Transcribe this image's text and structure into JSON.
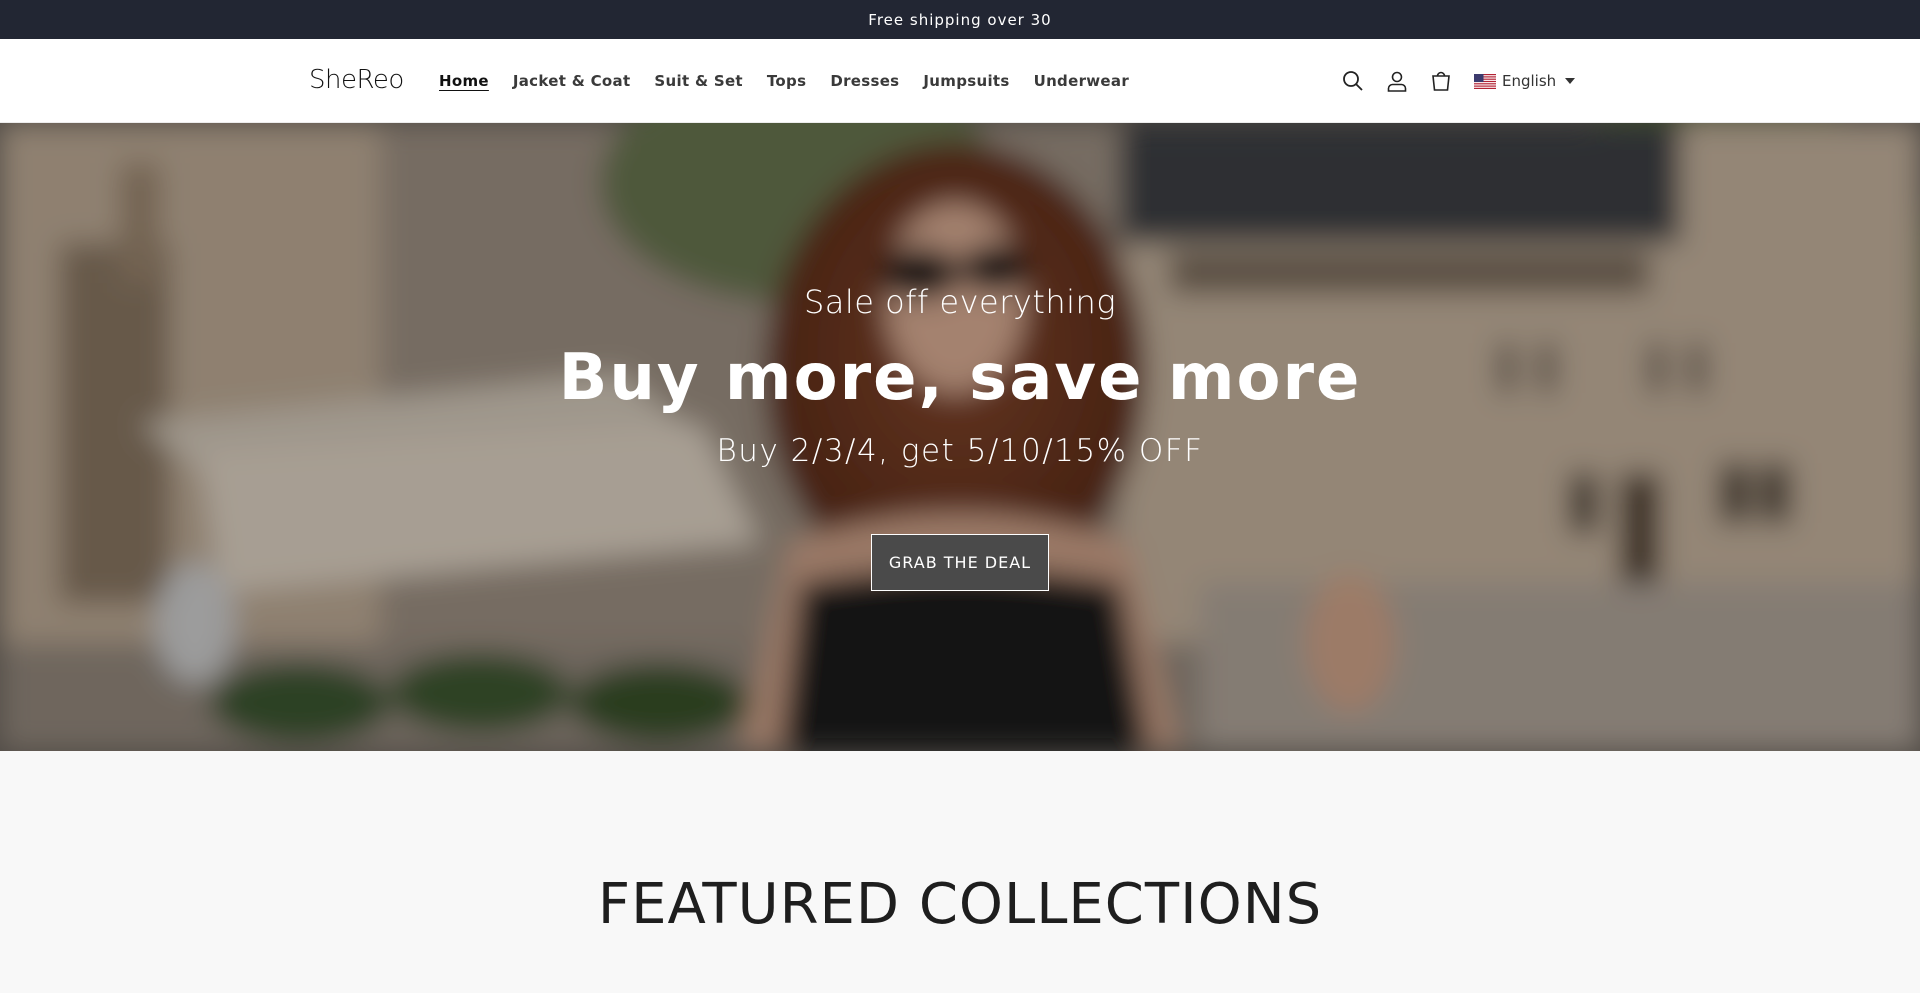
{
  "announcement": {
    "text": "Free shipping over  30"
  },
  "header": {
    "logo": "SheReo",
    "nav": [
      {
        "label": "Home",
        "active": true
      },
      {
        "label": "Jacket & Coat"
      },
      {
        "label": "Suit & Set"
      },
      {
        "label": "Tops"
      },
      {
        "label": "Dresses"
      },
      {
        "label": "Jumpsuits"
      },
      {
        "label": "Underwear"
      }
    ],
    "icons": [
      "search-icon",
      "account-icon",
      "cart-icon"
    ],
    "language": {
      "label": "English",
      "flag": "us-flag-icon"
    }
  },
  "hero": {
    "kicker": "Sale off everything",
    "title": "Buy more, save more",
    "subtitle": "Buy 2/3/4, get 5/10/15% OFF",
    "button": "GRAB THE DEAL"
  },
  "featured": {
    "title": "FEATURED COLLECTIONS"
  },
  "colors": {
    "announcement_bg": "#222633",
    "button_bg": "#4a4a4a",
    "page_bg": "#f8f8f8"
  }
}
